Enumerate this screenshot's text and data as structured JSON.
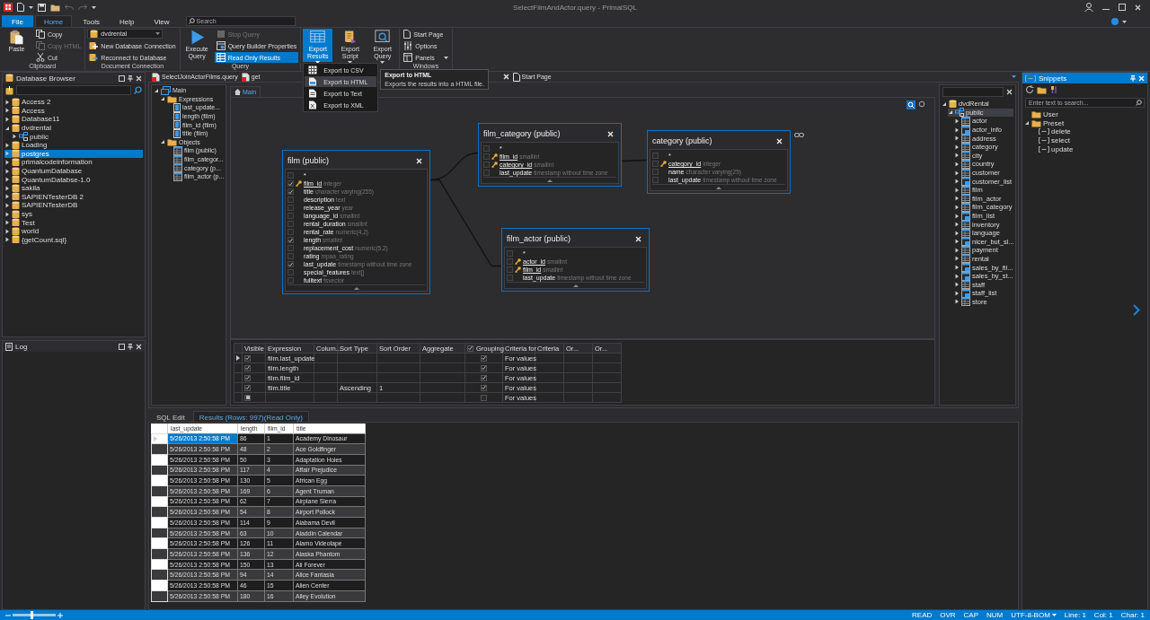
{
  "window": {
    "title": "SelectFilmAndActor.query - PrimalSQL"
  },
  "menu_tabs": [
    {
      "label": "File",
      "kind": "file",
      "selected": false
    },
    {
      "label": "Home",
      "kind": "tab",
      "selected": true
    },
    {
      "label": "Tools",
      "kind": "tab",
      "selected": false
    },
    {
      "label": "Help",
      "kind": "tab",
      "selected": false
    },
    {
      "label": "View",
      "kind": "tab",
      "selected": false
    }
  ],
  "search": {
    "placeholder": "Search"
  },
  "ribbon": {
    "groups": [
      {
        "label": "Clipboard",
        "columns": [
          [
            {
              "kind": "large",
              "label": "Paste",
              "on": false
            }
          ],
          [
            {
              "kind": "small",
              "label": "Copy",
              "disabled": false,
              "on": false
            },
            {
              "kind": "small",
              "label": "Copy HTML",
              "disabled": true,
              "on": false
            },
            {
              "kind": "small",
              "label": "Cut",
              "disabled": false,
              "on": false
            }
          ]
        ]
      },
      {
        "label": "Document Connection",
        "columns": [
          [
            {
              "kind": "combo",
              "value": "dvdrental"
            },
            {
              "kind": "small",
              "label": "New Database Connection",
              "disabled": false,
              "on": false
            },
            {
              "kind": "small",
              "label": "Reconnect to Database",
              "disabled": false,
              "on": false
            }
          ]
        ]
      },
      {
        "label": "Query",
        "columns": [
          [
            {
              "kind": "large",
              "label": "Execute Query",
              "on": false
            }
          ],
          [
            {
              "kind": "small",
              "label": "Stop Query",
              "disabled": true,
              "on": false
            },
            {
              "kind": "small",
              "label": "Query Builder Properties",
              "disabled": false,
              "on": false
            },
            {
              "kind": "small",
              "label": "Read Only Results",
              "disabled": false,
              "on": true
            }
          ]
        ]
      },
      {
        "columns": [
          [
            {
              "kind": "large",
              "label": "Export Results",
              "on": true,
              "dropdown": true
            }
          ],
          [
            {
              "kind": "large",
              "label": "Export Script",
              "on": false,
              "dropdown": true
            }
          ],
          [
            {
              "kind": "large",
              "label": "Export Query",
              "on": false,
              "dropdown": true
            }
          ]
        ]
      },
      {
        "label": "Windows",
        "columns": [
          [
            {
              "kind": "small",
              "label": "Start Page",
              "disabled": false,
              "on": false
            },
            {
              "kind": "small",
              "label": "Options",
              "disabled": false,
              "on": false
            },
            {
              "kind": "small",
              "label": "Panels",
              "disabled": false,
              "on": false,
              "dropdown": true
            }
          ]
        ]
      }
    ]
  },
  "export_menu": {
    "items": [
      {
        "label": "Export to CSV",
        "selected": false
      },
      {
        "label": "Export to HTML",
        "selected": true
      },
      {
        "label": "Export to Text",
        "selected": false
      },
      {
        "label": "Export to XML",
        "selected": false
      }
    ]
  },
  "tooltip": {
    "title": "Export to HTML",
    "text": "Exports the results into a HTML file."
  },
  "database_browser": {
    "title": "Database Browser",
    "items": [
      {
        "label": "Access 2",
        "kind": "database",
        "expanded": false,
        "selected": false
      },
      {
        "label": "Access",
        "kind": "database",
        "expanded": false,
        "selected": false
      },
      {
        "label": "Database11",
        "kind": "database",
        "expanded": false,
        "selected": false
      },
      {
        "label": "dvdrental",
        "kind": "database",
        "expanded": true,
        "selected": false,
        "children": [
          {
            "label": "public",
            "kind": "schema",
            "expanded": false,
            "selected": false
          }
        ]
      },
      {
        "label": "Loading",
        "kind": "database",
        "expanded": false,
        "selected": false
      },
      {
        "label": "postgres",
        "kind": "database",
        "expanded": false,
        "selected": true
      },
      {
        "label": "primalcodeinformation",
        "kind": "database",
        "expanded": false,
        "selected": false
      },
      {
        "label": "QuantumDatabase",
        "kind": "database",
        "expanded": false,
        "selected": false
      },
      {
        "label": "QuantumDatabse-1.0",
        "kind": "database",
        "expanded": false,
        "selected": false
      },
      {
        "label": "sakila",
        "kind": "database",
        "expanded": false,
        "selected": false
      },
      {
        "label": "SAPIENTesterDB 2",
        "kind": "database",
        "expanded": false,
        "selected": false
      },
      {
        "label": "SAPIENTesterDB",
        "kind": "database",
        "expanded": false,
        "selected": false
      },
      {
        "label": "sys",
        "kind": "database",
        "expanded": false,
        "selected": false
      },
      {
        "label": "Test",
        "kind": "database",
        "expanded": false,
        "selected": false
      },
      {
        "label": "world",
        "kind": "database",
        "expanded": false,
        "selected": false
      },
      {
        "label": "{getCount.sql}",
        "kind": "database",
        "expanded": false,
        "selected": false
      }
    ]
  },
  "log_panel": {
    "title": "Log"
  },
  "document_tabs": [
    {
      "label": "SelectJoinActorFilms.query",
      "closable": false
    },
    {
      "label": "get",
      "closable": true
    },
    {
      "label": "Start Page",
      "closable": false
    }
  ],
  "query_tree": {
    "items": [
      {
        "label": "Main",
        "kind": "query",
        "expanded": true,
        "children": [
          {
            "label": "Expressions",
            "kind": "folder",
            "expanded": true,
            "children": [
              {
                "label": "last_update...",
                "kind": "field"
              },
              {
                "label": "length (film)",
                "kind": "field"
              },
              {
                "label": "film_id (film)",
                "kind": "field"
              },
              {
                "label": "title (film)",
                "kind": "field"
              }
            ]
          },
          {
            "label": "Objects",
            "kind": "folder",
            "expanded": true,
            "children": [
              {
                "label": "film (public)",
                "kind": "table"
              },
              {
                "label": "film_categor...",
                "kind": "table"
              },
              {
                "label": "category (p...",
                "kind": "table"
              },
              {
                "label": "film_actor (p...",
                "kind": "table"
              }
            ]
          }
        ]
      }
    ]
  },
  "diagram": {
    "tabs": [
      {
        "label": "Main",
        "selected": true
      }
    ],
    "tables": [
      {
        "title": "film (public)",
        "columns": [
          {
            "name": "*",
            "checked": false,
            "key": false
          },
          {
            "name": "film_id",
            "type": "integer",
            "checked": true,
            "key": true
          },
          {
            "name": "title",
            "type": "character varying(255)",
            "checked": true,
            "key": false
          },
          {
            "name": "description",
            "type": "text",
            "checked": false,
            "key": false
          },
          {
            "name": "release_year",
            "type": "year",
            "checked": false,
            "key": false
          },
          {
            "name": "language_id",
            "type": "smallint",
            "checked": false,
            "key": false
          },
          {
            "name": "rental_duration",
            "type": "smallint",
            "checked": false,
            "key": false
          },
          {
            "name": "rental_rate",
            "type": "numeric(4,2)",
            "checked": false,
            "key": false
          },
          {
            "name": "length",
            "type": "smallint",
            "checked": true,
            "key": false
          },
          {
            "name": "replacement_cost",
            "type": "numeric(5,2)",
            "checked": false,
            "key": false
          },
          {
            "name": "rating",
            "type": "mpaa_rating",
            "checked": false,
            "key": false
          },
          {
            "name": "last_update",
            "type": "timestamp without time zone",
            "checked": true,
            "key": false
          },
          {
            "name": "special_features",
            "type": "text[]",
            "checked": false,
            "key": false
          },
          {
            "name": "fulltext",
            "type": "tsvector",
            "checked": false,
            "key": false
          }
        ]
      },
      {
        "title": "film_category (public)",
        "columns": [
          {
            "name": "*",
            "checked": false,
            "key": false
          },
          {
            "name": "film_id",
            "type": "smallint",
            "checked": false,
            "key": true
          },
          {
            "name": "category_id",
            "type": "smallint",
            "checked": false,
            "key": true
          },
          {
            "name": "last_update",
            "type": "timestamp without time zone",
            "checked": false,
            "key": false
          }
        ]
      },
      {
        "title": "category (public)",
        "columns": [
          {
            "name": "*",
            "checked": false,
            "key": false
          },
          {
            "name": "category_id",
            "type": "integer",
            "checked": false,
            "key": true
          },
          {
            "name": "name",
            "type": "character varying(25)",
            "checked": false,
            "key": false
          },
          {
            "name": "last_update",
            "type": "timestamp without time zone",
            "checked": false,
            "key": false
          }
        ]
      },
      {
        "title": "film_actor (public)",
        "columns": [
          {
            "name": "*",
            "checked": false,
            "key": false
          },
          {
            "name": "actor_id",
            "type": "smallint",
            "checked": false,
            "key": true
          },
          {
            "name": "film_id",
            "type": "smallint",
            "checked": false,
            "key": true
          },
          {
            "name": "last_update",
            "type": "timestamp without time zone",
            "checked": false,
            "key": false
          }
        ]
      }
    ]
  },
  "criteria_grid": {
    "columns": [
      {
        "label": "Visible"
      },
      {
        "label": "Expression"
      },
      {
        "label": "Colum..."
      },
      {
        "label": "Sort Type"
      },
      {
        "label": "Sort Order"
      },
      {
        "label": "Aggregate"
      },
      {
        "label": "Grouping",
        "checked": true
      },
      {
        "label": "Criteria for"
      },
      {
        "label": "Criteria"
      },
      {
        "label": "Or..."
      },
      {
        "label": "Or..."
      }
    ],
    "rows": [
      {
        "kind": "row",
        "current": true,
        "visible": true,
        "expression": "film.last_update",
        "grouping": true,
        "criteria_for": "For values"
      },
      {
        "kind": "row",
        "current": false,
        "visible": true,
        "expression": "film.length",
        "grouping": true,
        "criteria_for": "For values"
      },
      {
        "kind": "row",
        "current": false,
        "visible": true,
        "expression": "film.film_id",
        "grouping": true,
        "criteria_for": "For values"
      },
      {
        "kind": "row",
        "current": false,
        "visible": true,
        "expression": "film.title",
        "sort_type": "Ascending",
        "sort_order": "1",
        "grouping": true,
        "criteria_for": "For values"
      },
      {
        "kind": "new",
        "current": false,
        "grouping": false,
        "criteria_for": "For values"
      }
    ]
  },
  "results_tabs": [
    {
      "label": "SQL Edit",
      "selected": false
    },
    {
      "label": "Results (Rows: 997)(Read Only)",
      "selected": true
    }
  ],
  "results_table": {
    "columns": [
      "last_update",
      "length",
      "film_id",
      "title"
    ],
    "rows": [
      {
        "cells": [
          "5/26/2013 2:50:58 PM",
          "86",
          "1",
          "Academy Dinosaur"
        ],
        "current": true
      },
      {
        "cells": [
          "5/26/2013 2:50:58 PM",
          "48",
          "2",
          "Ace Goldfinger"
        ],
        "current": false
      },
      {
        "cells": [
          "5/26/2013 2:50:58 PM",
          "50",
          "3",
          "Adaptation Holes"
        ],
        "current": false
      },
      {
        "cells": [
          "5/26/2013 2:50:58 PM",
          "117",
          "4",
          "Affair Prejudice"
        ],
        "current": false
      },
      {
        "cells": [
          "5/26/2013 2:50:58 PM",
          "130",
          "5",
          "African Egg"
        ],
        "current": false
      },
      {
        "cells": [
          "5/26/2013 2:50:58 PM",
          "169",
          "6",
          "Agent Truman"
        ],
        "current": false
      },
      {
        "cells": [
          "5/26/2013 2:50:58 PM",
          "62",
          "7",
          "Airplane Sierra"
        ],
        "current": false
      },
      {
        "cells": [
          "5/26/2013 2:50:58 PM",
          "54",
          "8",
          "Airport Pollock"
        ],
        "current": false
      },
      {
        "cells": [
          "5/26/2013 2:50:58 PM",
          "114",
          "9",
          "Alabama Devil"
        ],
        "current": false
      },
      {
        "cells": [
          "5/26/2013 2:50:58 PM",
          "63",
          "10",
          "Aladdin Calendar"
        ],
        "current": false
      },
      {
        "cells": [
          "5/26/2013 2:50:58 PM",
          "126",
          "11",
          "Alamo Videotape"
        ],
        "current": false
      },
      {
        "cells": [
          "5/26/2013 2:50:58 PM",
          "136",
          "12",
          "Alaska Phantom"
        ],
        "current": false
      },
      {
        "cells": [
          "5/26/2013 2:50:58 PM",
          "150",
          "13",
          "Ali Forever"
        ],
        "current": false
      },
      {
        "cells": [
          "5/26/2013 2:50:58 PM",
          "94",
          "14",
          "Alice Fantasia"
        ],
        "current": false
      },
      {
        "cells": [
          "5/26/2013 2:50:58 PM",
          "46",
          "15",
          "Alien Center"
        ],
        "current": false
      },
      {
        "cells": [
          "5/26/2013 2:50:58 PM",
          "180",
          "16",
          "Alley Evolution"
        ],
        "current": false
      }
    ]
  },
  "schema_tree": {
    "items": [
      {
        "label": "dvdRental",
        "kind": "database",
        "expanded": true,
        "selected": false,
        "children": [
          {
            "label": "public",
            "kind": "schema",
            "expanded": true,
            "selected": true,
            "children": [
              {
                "label": "actor",
                "kind": "table",
                "expanded": false,
                "selected": false
              },
              {
                "label": "actor_info",
                "kind": "view",
                "expanded": false,
                "selected": false
              },
              {
                "label": "address",
                "kind": "table",
                "expanded": false,
                "selected": false
              },
              {
                "label": "category",
                "kind": "table",
                "expanded": false,
                "selected": false
              },
              {
                "label": "city",
                "kind": "table",
                "expanded": false,
                "selected": false
              },
              {
                "label": "country",
                "kind": "table",
                "expanded": false,
                "selected": false
              },
              {
                "label": "customer",
                "kind": "table",
                "expanded": false,
                "selected": false
              },
              {
                "label": "customer_list",
                "kind": "view",
                "expanded": false,
                "selected": false
              },
              {
                "label": "film",
                "kind": "table",
                "expanded": false,
                "selected": false
              },
              {
                "label": "film_actor",
                "kind": "table",
                "expanded": false,
                "selected": false
              },
              {
                "label": "film_category",
                "kind": "table",
                "expanded": false,
                "selected": false
              },
              {
                "label": "film_list",
                "kind": "view",
                "expanded": false,
                "selected": false
              },
              {
                "label": "inventory",
                "kind": "table",
                "expanded": false,
                "selected": false
              },
              {
                "label": "language",
                "kind": "table",
                "expanded": false,
                "selected": false
              },
              {
                "label": "nicer_but_sl...",
                "kind": "view",
                "expanded": false,
                "selected": false
              },
              {
                "label": "payment",
                "kind": "table",
                "expanded": false,
                "selected": false
              },
              {
                "label": "rental",
                "kind": "table",
                "expanded": false,
                "selected": false
              },
              {
                "label": "sales_by_fil...",
                "kind": "view",
                "expanded": false,
                "selected": false
              },
              {
                "label": "sales_by_st...",
                "kind": "view",
                "expanded": false,
                "selected": false
              },
              {
                "label": "staff",
                "kind": "table",
                "expanded": false,
                "selected": false
              },
              {
                "label": "staff_list",
                "kind": "view",
                "expanded": false,
                "selected": false
              },
              {
                "label": "store",
                "kind": "table",
                "expanded": false,
                "selected": false
              }
            ]
          }
        ]
      }
    ]
  },
  "snippets": {
    "title": "Snippets",
    "search": {
      "placeholder": "Enter text to search..."
    },
    "items": [
      {
        "label": "User",
        "kind": "folder"
      },
      {
        "label": "Preset",
        "kind": "folder",
        "expanded": true,
        "children": [
          {
            "label": "delete",
            "kind": "snippet"
          },
          {
            "label": "select",
            "kind": "snippet"
          },
          {
            "label": "update",
            "kind": "snippet"
          }
        ]
      }
    ]
  },
  "status_bar": {
    "zoom": {
      "level": 0.45
    },
    "indicators": [
      "READ",
      "OVR",
      "CAP",
      "NUM"
    ],
    "encoding": "UTF-8-BOM",
    "position": [
      "Line: 1",
      "Col: 1",
      "Char: 1"
    ]
  }
}
